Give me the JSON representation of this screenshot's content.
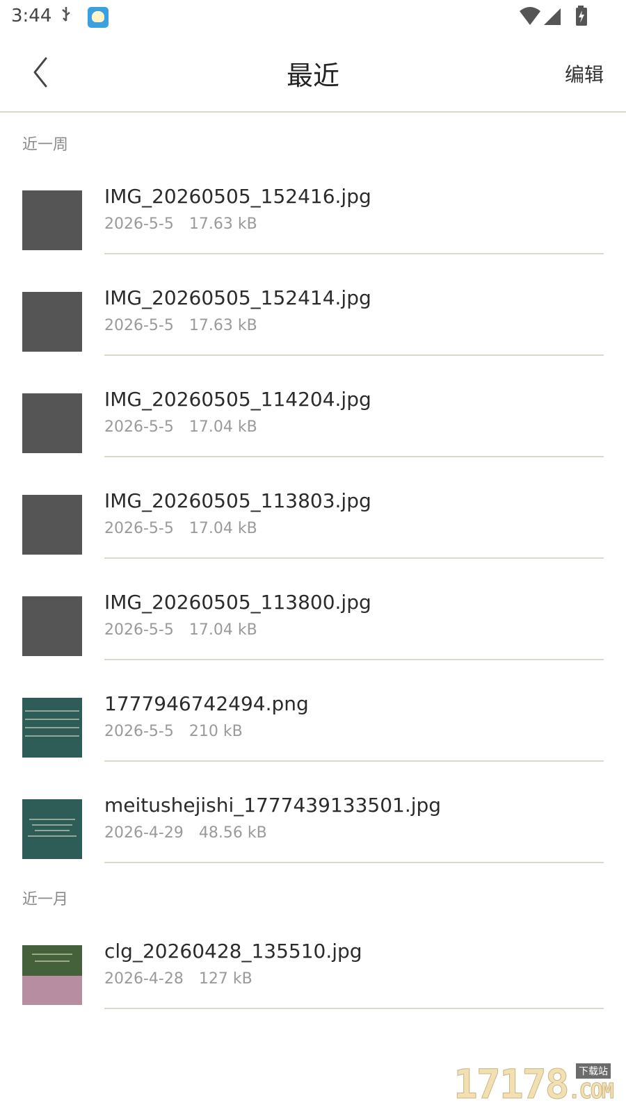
{
  "status_bar": {
    "time": "3:44",
    "icons": [
      "usb-icon",
      "app-notification-icon",
      "wifi-icon",
      "signal-icon",
      "battery-charging-icon"
    ]
  },
  "header": {
    "back_icon": "chevron-left-icon",
    "title": "最近",
    "edit_label": "编辑"
  },
  "sections": [
    {
      "label": "近一周"
    },
    {
      "label": "近一月"
    }
  ],
  "files": [
    {
      "name": "IMG_20260505_152416.jpg",
      "date": "2026-5-5",
      "size": "17.63 kB",
      "thumb": "gray"
    },
    {
      "name": "IMG_20260505_152414.jpg",
      "date": "2026-5-5",
      "size": "17.63 kB",
      "thumb": "gray"
    },
    {
      "name": "IMG_20260505_114204.jpg",
      "date": "2026-5-5",
      "size": "17.04 kB",
      "thumb": "gray"
    },
    {
      "name": "IMG_20260505_113803.jpg",
      "date": "2026-5-5",
      "size": "17.04 kB",
      "thumb": "gray"
    },
    {
      "name": "IMG_20260505_113800.jpg",
      "date": "2026-5-5",
      "size": "17.04 kB",
      "thumb": "gray"
    },
    {
      "name": "1777946742494.png",
      "date": "2026-5-5",
      "size": "210 kB",
      "thumb": "teal"
    },
    {
      "name": "meitushejishi_1777439133501.jpg",
      "date": "2026-4-29",
      "size": "48.56 kB",
      "thumb": "teal"
    },
    {
      "name": "clg_20260428_135510.jpg",
      "date": "2026-4-28",
      "size": "127 kB",
      "thumb": "split"
    }
  ],
  "watermark": {
    "text": "17178",
    "suffix": ".COM",
    "tag": "下载站"
  },
  "colors": {
    "divider": "#d9d9cc",
    "thumb_gray": "#555555",
    "thumb_teal": "#2e5d58",
    "thumb_green": "#44613c",
    "thumb_pink": "#b78da2"
  }
}
